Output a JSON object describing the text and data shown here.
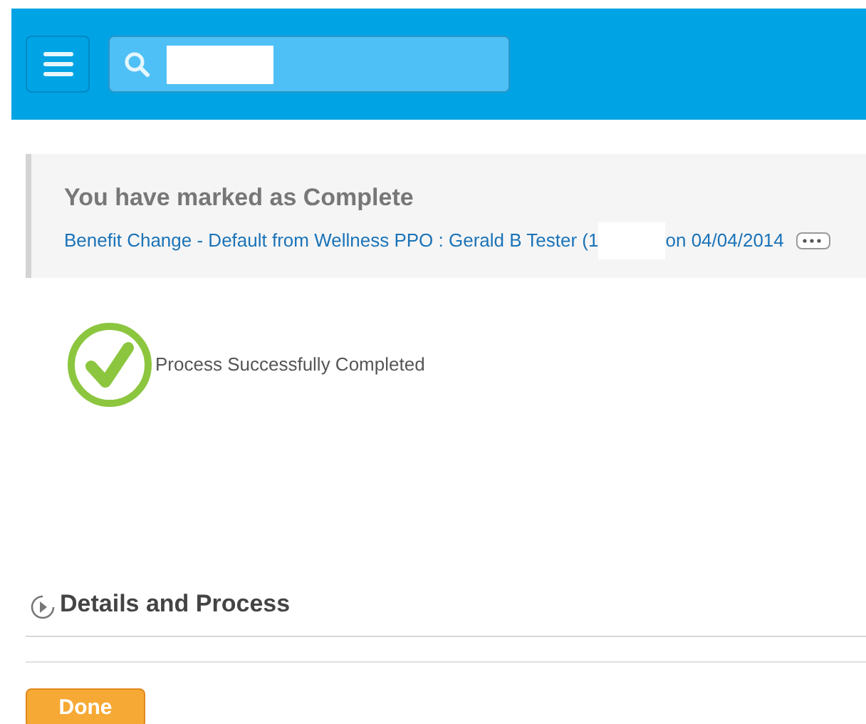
{
  "notice": {
    "title": "You have marked as Complete",
    "link_start": "Benefit Change - Default from Wellness PPO : Gerald B Tester (1",
    "link_end": "on 04/04/2014"
  },
  "result": {
    "kind": "success",
    "message": "Process Successfully Completed"
  },
  "section": {
    "title": "Details and Process",
    "expanded": false
  },
  "buttons": [
    {
      "label": "Done"
    }
  ]
}
